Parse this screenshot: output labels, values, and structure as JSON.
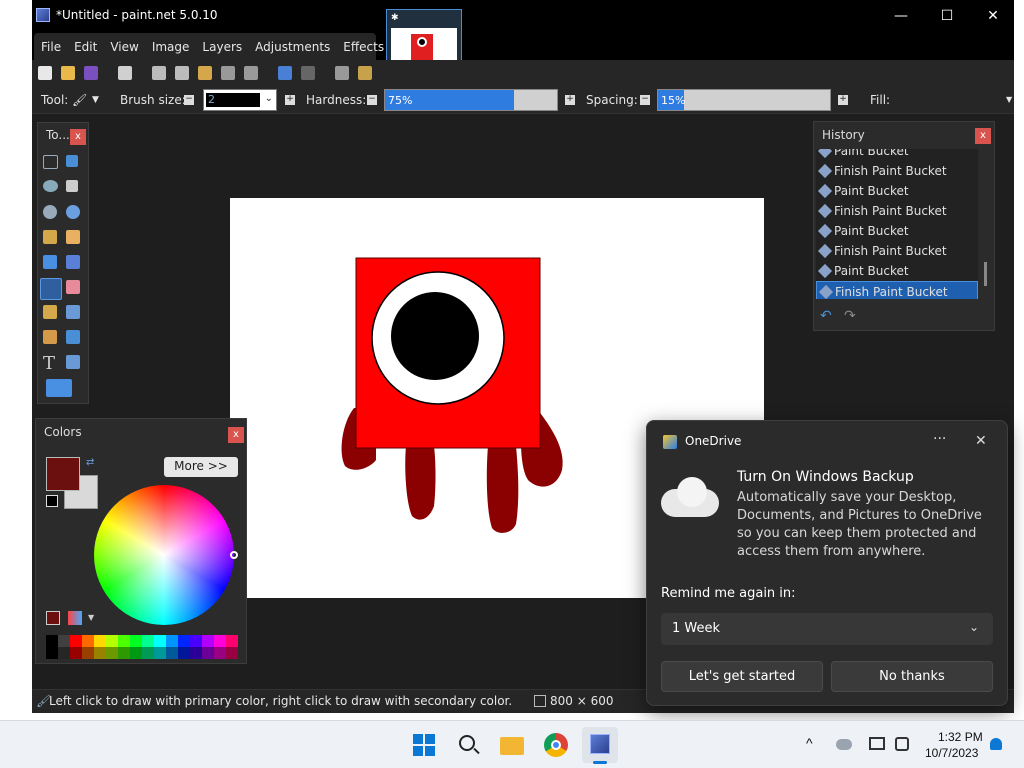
{
  "window": {
    "title": "*Untitled - paint.net 5.0.10",
    "minimize": "—",
    "maximize": "☐",
    "close": "✕"
  },
  "menu": [
    "File",
    "Edit",
    "View",
    "Image",
    "Layers",
    "Adjustments",
    "Effects"
  ],
  "toolbar": {
    "tool_label": "Tool:",
    "brush_size_label": "Brush size:",
    "brush_size_value": "2",
    "hardness_label": "Hardness:",
    "hardness_value": "75%",
    "hardness_fraction": 0.75,
    "spacing_label": "Spacing:",
    "spacing_value": "15%",
    "spacing_fraction": 0.15,
    "fill_label": "Fill:"
  },
  "tools_panel": {
    "title": "To..."
  },
  "history": {
    "title": "History",
    "items": [
      "Paint Bucket",
      "Finish Paint Bucket",
      "Paint Bucket",
      "Finish Paint Bucket",
      "Paint Bucket",
      "Finish Paint Bucket",
      "Paint Bucket",
      "Finish Paint Bucket"
    ],
    "selected_index": 7
  },
  "colors_panel": {
    "title": "Colors",
    "more_label": "More >>",
    "primary": "#6b0f0f",
    "secondary": "#d9d9d9",
    "palette": [
      "#000000",
      "#404040",
      "#ff0000",
      "#ff6a00",
      "#ffd800",
      "#b6ff00",
      "#4cff00",
      "#00ff21",
      "#00ff90",
      "#00ffff",
      "#0094ff",
      "#0026ff",
      "#4800ff",
      "#b200ff",
      "#ff00dc",
      "#ff006e"
    ]
  },
  "canvas": {
    "fill": "#ffffff",
    "character_color": "#ff0000",
    "leg_color": "#8b0000",
    "eye_white": "#ffffff",
    "pupil": "#000000"
  },
  "status": {
    "hint": "Left click to draw with primary color, right click to draw with secondary color.",
    "size": "800 × 600"
  },
  "toast": {
    "app": "OneDrive",
    "menu_dots": "···",
    "close": "✕",
    "heading": "Turn On Windows Backup",
    "body": "Automatically save your Desktop, Documents, and Pictures to OneDrive so you can keep them protected and access them from anywhere.",
    "remind_label": "Remind me again in:",
    "remind_value": "1 Week",
    "primary_btn": "Let's get started",
    "secondary_btn": "No thanks"
  },
  "taskbar": {
    "time": "1:32 PM",
    "date": "10/7/2023",
    "chevron": "^"
  }
}
